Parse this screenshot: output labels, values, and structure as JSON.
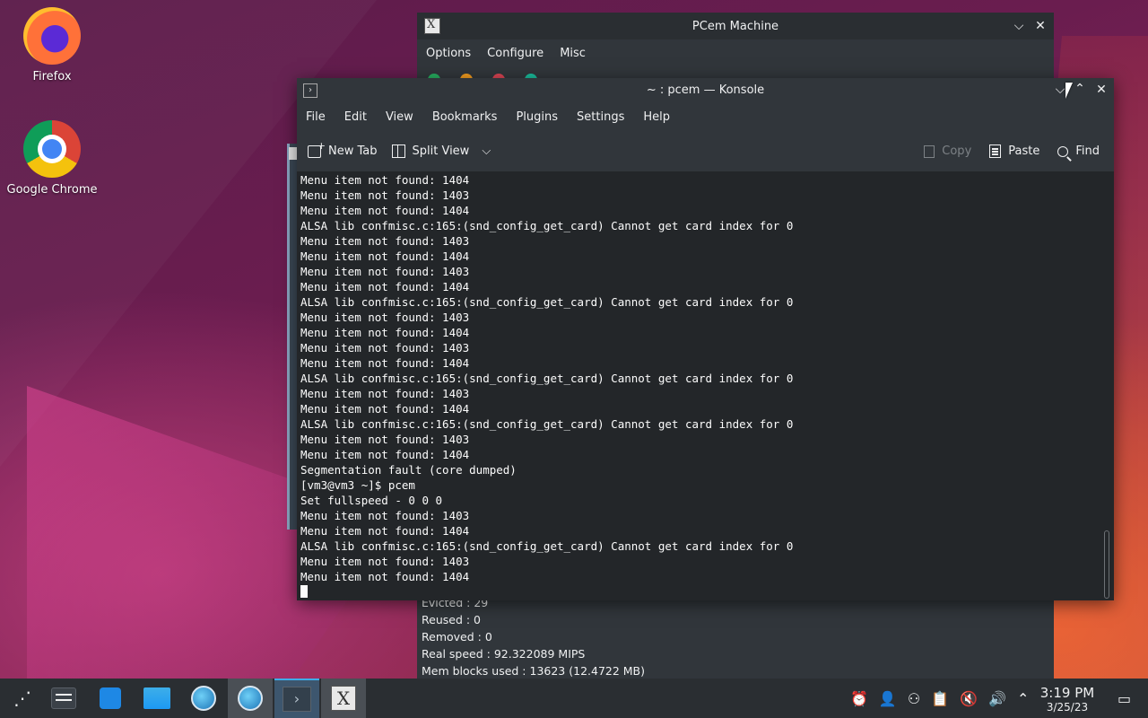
{
  "desktop": {
    "icons": [
      {
        "label": "Firefox",
        "icon": "firefox-icon"
      },
      {
        "label": "Google Chrome",
        "icon": "chrome-icon"
      }
    ]
  },
  "pcem": {
    "title": "PCem Machine",
    "menu": [
      "Options",
      "Configure",
      "Misc"
    ],
    "stats": [
      "Evicted : 29",
      "Reused : 0",
      "Removed : 0",
      "Real speed : 92.322089 MIPS",
      "Mem blocks used : 13623 (12.4722 MB)"
    ]
  },
  "konsole": {
    "title": "~ : pcem — Konsole",
    "menu": [
      "File",
      "Edit",
      "View",
      "Bookmarks",
      "Plugins",
      "Settings",
      "Help"
    ],
    "toolbar": {
      "new_tab": "New Tab",
      "split_view": "Split View",
      "copy": "Copy",
      "paste": "Paste",
      "find": "Find"
    },
    "terminal_lines": [
      "Menu item not found: 1404",
      "Menu item not found: 1403",
      "Menu item not found: 1404",
      "ALSA lib confmisc.c:165:(snd_config_get_card) Cannot get card index for 0",
      "Menu item not found: 1403",
      "Menu item not found: 1404",
      "Menu item not found: 1403",
      "Menu item not found: 1404",
      "ALSA lib confmisc.c:165:(snd_config_get_card) Cannot get card index for 0",
      "Menu item not found: 1403",
      "Menu item not found: 1404",
      "Menu item not found: 1403",
      "Menu item not found: 1404",
      "ALSA lib confmisc.c:165:(snd_config_get_card) Cannot get card index for 0",
      "Menu item not found: 1403",
      "Menu item not found: 1404",
      "ALSA lib confmisc.c:165:(snd_config_get_card) Cannot get card index for 0",
      "Menu item not found: 1403",
      "Menu item not found: 1404",
      "Segmentation fault (core dumped)",
      "[vm3@vm3 ~]$ pcem",
      "Set fullspeed - 0 0 0",
      "Menu item not found: 1403",
      "Menu item not found: 1404",
      "ALSA lib confmisc.c:165:(snd_config_get_card) Cannot get card index for 0",
      "Menu item not found: 1403",
      "Menu item not found: 1404"
    ]
  },
  "taskbar": {
    "time": "3:19 PM",
    "date": "3/25/23"
  },
  "colors": {
    "accent": "#3daee9",
    "window_bg": "#31363b",
    "terminal_bg": "#232629"
  }
}
